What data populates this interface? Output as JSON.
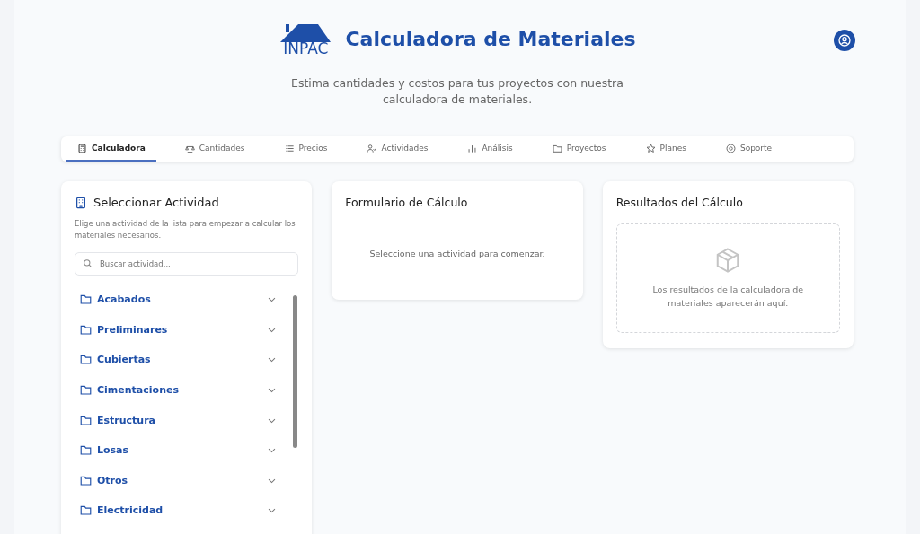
{
  "header": {
    "logo_text": "INPAC",
    "title": "Calculadora de Materiales",
    "subtitle": "Estima cantidades y costos para tus proyectos con nuestra calculadora de materiales."
  },
  "tabs": [
    {
      "label": "Calculadora",
      "selected": true
    },
    {
      "label": "Cantidades",
      "selected": false
    },
    {
      "label": "Precios",
      "selected": false
    },
    {
      "label": "Actividades",
      "selected": false
    },
    {
      "label": "Análisis",
      "selected": false
    },
    {
      "label": "Proyectos",
      "selected": false
    },
    {
      "label": "Planes",
      "selected": false
    },
    {
      "label": "Soporte",
      "selected": false
    }
  ],
  "activity_panel": {
    "title": "Seleccionar Actividad",
    "description": "Elige una actividad de la lista para empezar a calcular los materiales necesarios.",
    "search": {
      "placeholder": "Buscar actividad..."
    },
    "categories": [
      {
        "label": "Acabados",
        "expanded": false
      },
      {
        "label": "Preliminares",
        "expanded": false
      },
      {
        "label": "Cubiertas",
        "expanded": false
      },
      {
        "label": "Cimentaciones",
        "expanded": false
      },
      {
        "label": "Estructura",
        "expanded": false
      },
      {
        "label": "Losas",
        "expanded": false
      },
      {
        "label": "Otros",
        "expanded": false
      },
      {
        "label": "Electricidad",
        "expanded": false
      }
    ]
  },
  "form_panel": {
    "title": "Formulario de Cálculo",
    "message": "Seleccione una actividad para comenzar."
  },
  "results_panel": {
    "title": "Resultados del Cálculo",
    "message": "Los resultados de la calculadora de materiales aparecerán aquí."
  }
}
